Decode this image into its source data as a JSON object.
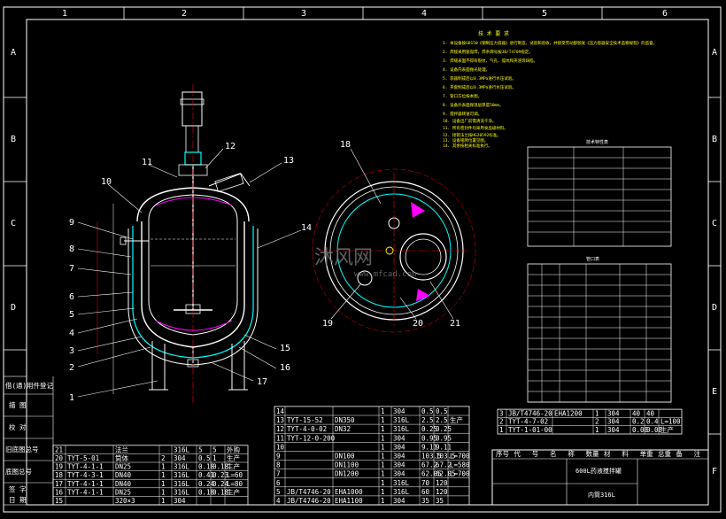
{
  "grid": {
    "top_columns": [
      "1",
      "2",
      "3",
      "4",
      "5",
      "6"
    ],
    "bottom_columns": [
      "1",
      "2",
      "3",
      "4",
      "5",
      "6"
    ],
    "left_rows": [
      "A",
      "B",
      "C",
      "D",
      "E",
      "F"
    ],
    "right_rows": [
      "A",
      "B",
      "C",
      "D",
      "E",
      "F"
    ]
  },
  "watermark": "沐风网",
  "watermark_url": "www.mfcad.com",
  "side_labels": [
    "借(通)用件登记",
    "描 图",
    "校 对",
    "旧底图总号",
    "底图总号",
    "签 字",
    "日 期"
  ],
  "title_block": {
    "name": "600L药液搅拌罐",
    "material_note": "内筒316L",
    "header": [
      "序号",
      "代",
      "号",
      "名",
      "称",
      "数量",
      "材",
      "料",
      "单重",
      "总重",
      "备",
      "注"
    ]
  },
  "callouts_left": [
    "1",
    "2",
    "3",
    "4",
    "5",
    "6",
    "7",
    "8",
    "9",
    "10",
    "11",
    "12",
    "13",
    "14",
    "15",
    "16",
    "17"
  ],
  "callouts_plan": [
    "18",
    "19",
    "20",
    "21"
  ],
  "bom_left": [
    {
      "no": "21",
      "code": "",
      "name": "法兰",
      "qty": "",
      "material": "316L",
      "unit": "5",
      "total": "5",
      "note": "外购"
    },
    {
      "no": "20",
      "code": "TYT-5-01",
      "name": "筒体",
      "qty": "2",
      "material": "304",
      "unit": "0.5",
      "total": "1",
      "note": "生产"
    },
    {
      "no": "19",
      "code": "TYT-4-1-1",
      "name": "DN25",
      "qty": "1",
      "material": "316L",
      "unit": "0.18",
      "total": "0.18",
      "note": "生产"
    },
    {
      "no": "18",
      "code": "TYT-4-3-1",
      "name": "DN40",
      "qty": "1",
      "material": "316L",
      "unit": "0.41",
      "total": "0.23",
      "note": "L=60"
    },
    {
      "no": "17",
      "code": "TYT-4-1-1",
      "name": "DN40",
      "qty": "1",
      "material": "316L",
      "unit": "0.24",
      "total": "0.24",
      "note": "L=80"
    },
    {
      "no": "16",
      "code": "TYT-4-1-1",
      "name": "DN25",
      "qty": "1",
      "material": "316L",
      "unit": "0.18",
      "total": "0.18",
      "note": "生产"
    },
    {
      "no": "15",
      "code": "",
      "name": "320×3",
      "qty": "1",
      "material": "304",
      "unit": "",
      "total": "",
      "note": ""
    }
  ],
  "bom_mid": [
    {
      "no": "14",
      "code": "",
      "name": "",
      "qty": "1",
      "material": "304",
      "unit": "0.5",
      "total": "0.5",
      "note": ""
    },
    {
      "no": "13",
      "code": "TYT-15-52",
      "name": "DN350",
      "qty": "1",
      "material": "316L",
      "unit": "2.5",
      "total": "2.5",
      "note": "生产"
    },
    {
      "no": "12",
      "code": "TYT-4-0-02",
      "name": "DN32",
      "qty": "1",
      "material": "316L",
      "unit": "0.25",
      "total": "0.25",
      "note": ""
    },
    {
      "no": "11",
      "code": "TYT-12-0-200",
      "name": "",
      "qty": "1",
      "material": "304",
      "unit": "0.95",
      "total": "0.95",
      "note": ""
    },
    {
      "no": "10",
      "code": "",
      "name": "",
      "qty": "1",
      "material": "304",
      "unit": "9.11",
      "total": "9.11",
      "note": ""
    },
    {
      "no": "9",
      "code": "",
      "name": "DN100",
      "qty": "1",
      "material": "304",
      "unit": "103.5",
      "total": "103.5",
      "note": "L=700"
    },
    {
      "no": "8",
      "code": "",
      "name": "DN1100",
      "qty": "1",
      "material": "304",
      "unit": "67.2",
      "total": "67.2",
      "note": "L=580"
    },
    {
      "no": "7",
      "code": "",
      "name": "DN1200",
      "qty": "1",
      "material": "304",
      "unit": "62.05",
      "total": "62.05",
      "note": "L=700"
    },
    {
      "no": "6",
      "code": "",
      "name": "",
      "qty": "1",
      "material": "316L",
      "unit": "70",
      "total": "120",
      "note": ""
    },
    {
      "no": "5",
      "code": "JB/T4746-20",
      "name": "EHA1000",
      "qty": "1",
      "material": "316L",
      "unit": "60",
      "total": "120",
      "note": ""
    },
    {
      "no": "4",
      "code": "JB/T4746-20",
      "name": "EHA1100",
      "qty": "1",
      "material": "304",
      "unit": "35",
      "total": "35",
      "note": ""
    }
  ],
  "bom_right": [
    {
      "no": "3",
      "code": "JB/T4746-20",
      "name": "EHA1200",
      "qty": "1",
      "material": "304",
      "unit": "40",
      "total": "40",
      "note": ""
    },
    {
      "no": "2",
      "code": "TYT-4-7-02",
      "name": "",
      "qty": "2",
      "material": "304",
      "unit": "0.2",
      "total": "0.4",
      "note": "L=100"
    },
    {
      "no": "1",
      "code": "TYT-1-01-00",
      "name": "",
      "qty": "1",
      "material": "304",
      "unit": "0.08",
      "total": "0.08",
      "note": "生产"
    }
  ],
  "spec_table_title": "技术特性表",
  "nozzle_table_title": "管口表",
  "tech_notes": [
    "技 术 要 求",
    "1. 本设备按GB150《钢制压力容器》进行制造、试验和验收，并接受劳动部颁发《压力容器安全技术监察规程》的监督。",
    "2. 焊接采用氩弧焊，焊条牌号按JB/T4709规定。",
    "3. 焊缝表面不得有裂纹、气孔、弧坑和夹渣等缺陷。",
    "4. 设备内表面抛光处理。",
    "5. 容器制成后以0.3MPa进行水压试验。",
    "6. 夹套制成后以0.3MPa进行水压试验。",
    "7. 管口方位按本图。",
    "8. 设备外表面保温层厚度50mm。",
    "9. 搅拌器转速可调。",
    "10. 设备出厂前需清洗干净。",
    "11. 所有密封件均采用食品级材料。",
    "12. 接管法兰按HG20592标准。",
    "13. 设备铭牌位置见图。",
    "14. 其余按相关标准执行。"
  ]
}
